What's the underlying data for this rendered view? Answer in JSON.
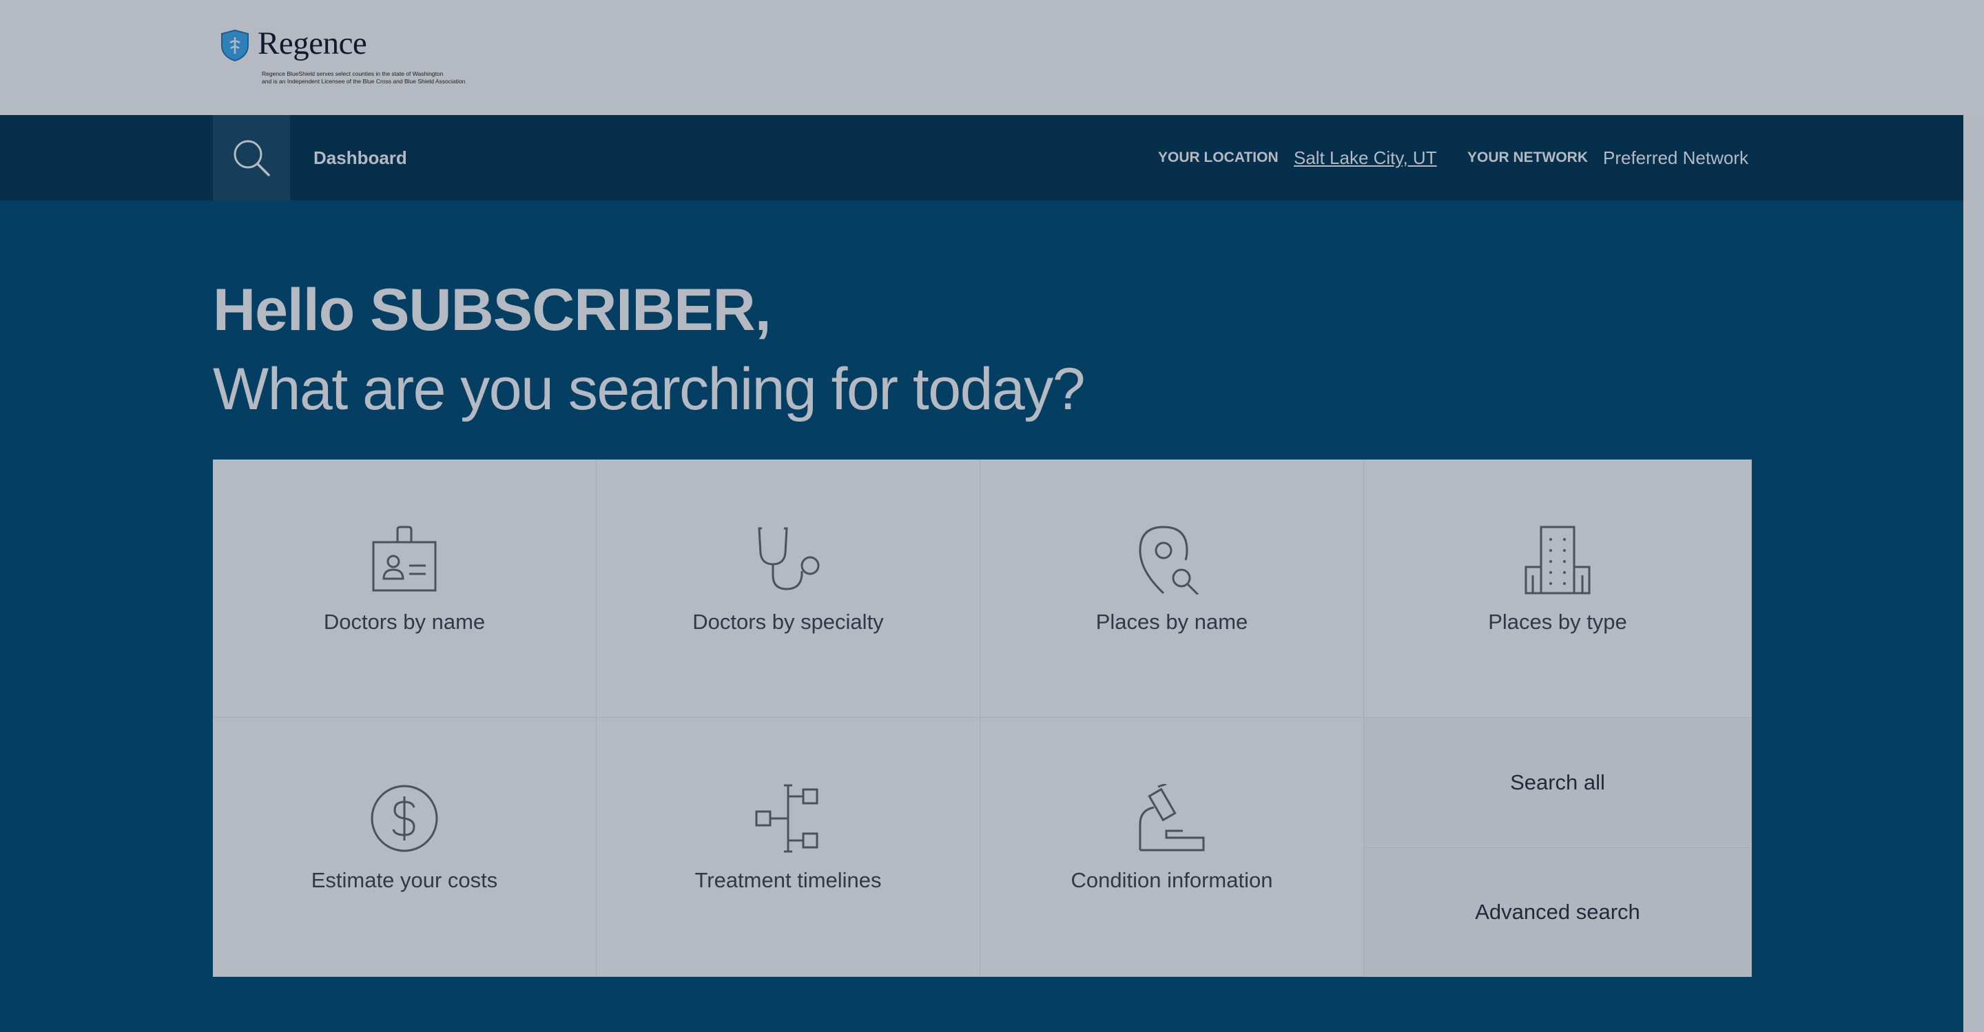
{
  "brand": {
    "name": "Regence",
    "fine_print": "Regence BlueShield serves select counties in the state of Washington\nand is an Independent Licensee of the Blue Cross and Blue Shield Association",
    "shield_color": "#2f7fb9"
  },
  "nav": {
    "search_icon": "search-icon",
    "dashboard": "Dashboard",
    "location_label": "YOUR LOCATION",
    "location_value": "Salt Lake City, UT",
    "network_label": "YOUR NETWORK",
    "network_value": "Preferred Network"
  },
  "hero": {
    "greeting": "Hello SUBSCRIBER,",
    "question": "What are you searching for today?"
  },
  "tiles": [
    {
      "label": "Doctors by name",
      "icon": "id-badge-icon"
    },
    {
      "label": "Doctors by specialty",
      "icon": "stethoscope-icon"
    },
    {
      "label": "Places by name",
      "icon": "location-search-icon"
    },
    {
      "label": "Places by type",
      "icon": "building-icon"
    },
    {
      "label": "Estimate your costs",
      "icon": "dollar-icon"
    },
    {
      "label": "Treatment timelines",
      "icon": "timeline-icon"
    },
    {
      "label": "Condition information",
      "icon": "microscope-icon"
    }
  ],
  "quick_links": {
    "search_all": "Search all",
    "advanced_search": "Advanced search"
  },
  "colors": {
    "overlay_gray": "#b5b9c1",
    "navbar": "#062f4b",
    "main_bg": "#053e63",
    "icon_stroke": "#49525e"
  }
}
